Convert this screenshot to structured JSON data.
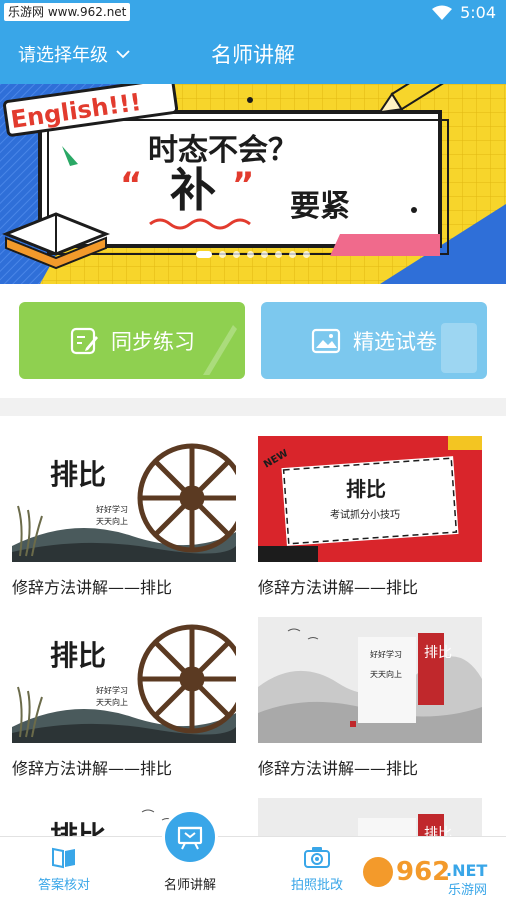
{
  "status": {
    "watermark_text": "乐游网 www.962.net",
    "time": "5:04"
  },
  "nav": {
    "grade_select": "请选择年级",
    "title": "名师讲解"
  },
  "banner": {
    "heading": "时态不会？",
    "big_char": "补",
    "tail": "要紧",
    "english_sign": "English!!!",
    "slide_count": 8,
    "active_slide": 0
  },
  "quick_actions": [
    {
      "label": "同步练习",
      "icon": "edit-note-icon",
      "color": "#8fd050"
    },
    {
      "label": "精选试卷",
      "icon": "image-paper-icon",
      "color": "#7cc8ee"
    }
  ],
  "videos": [
    {
      "caption": "修辞方法讲解——排比",
      "thumb_title": "排比",
      "thumb_sub1": "好好学习",
      "thumb_sub2": "天天向上",
      "style": "waterwheel"
    },
    {
      "caption": "修辞方法讲解——排比",
      "thumb_title": "排比",
      "thumb_sub1": "考试抓分小技巧",
      "thumb_badge": "NEW",
      "style": "red-card"
    },
    {
      "caption": "修辞方法讲解——排比",
      "thumb_title": "排比",
      "thumb_sub1": "好好学习",
      "thumb_sub2": "天天向上",
      "style": "waterwheel"
    },
    {
      "caption": "修辞方法讲解——排比",
      "thumb_title": "排比",
      "thumb_sub1": "好好学习",
      "thumb_sub2": "天天向上",
      "style": "ink-landscape"
    },
    {
      "caption": "",
      "thumb_title": "排比",
      "style": "waterwheel"
    },
    {
      "caption": "",
      "thumb_title": "排比",
      "style": "ink-landscape"
    }
  ],
  "bottom_nav": [
    {
      "label": "答案核对",
      "icon": "book-icon",
      "active": false
    },
    {
      "label": "名师讲解",
      "icon": "teacher-board-icon",
      "active": true
    },
    {
      "label": "拍照批改",
      "icon": "camera-icon",
      "active": false
    }
  ],
  "watermark_br": {
    "logo": "962",
    "suffix": ".NET",
    "sub": "乐游网"
  },
  "colors": {
    "primary": "#39a6e8",
    "practice": "#8fd050",
    "papers": "#7cc8ee"
  }
}
